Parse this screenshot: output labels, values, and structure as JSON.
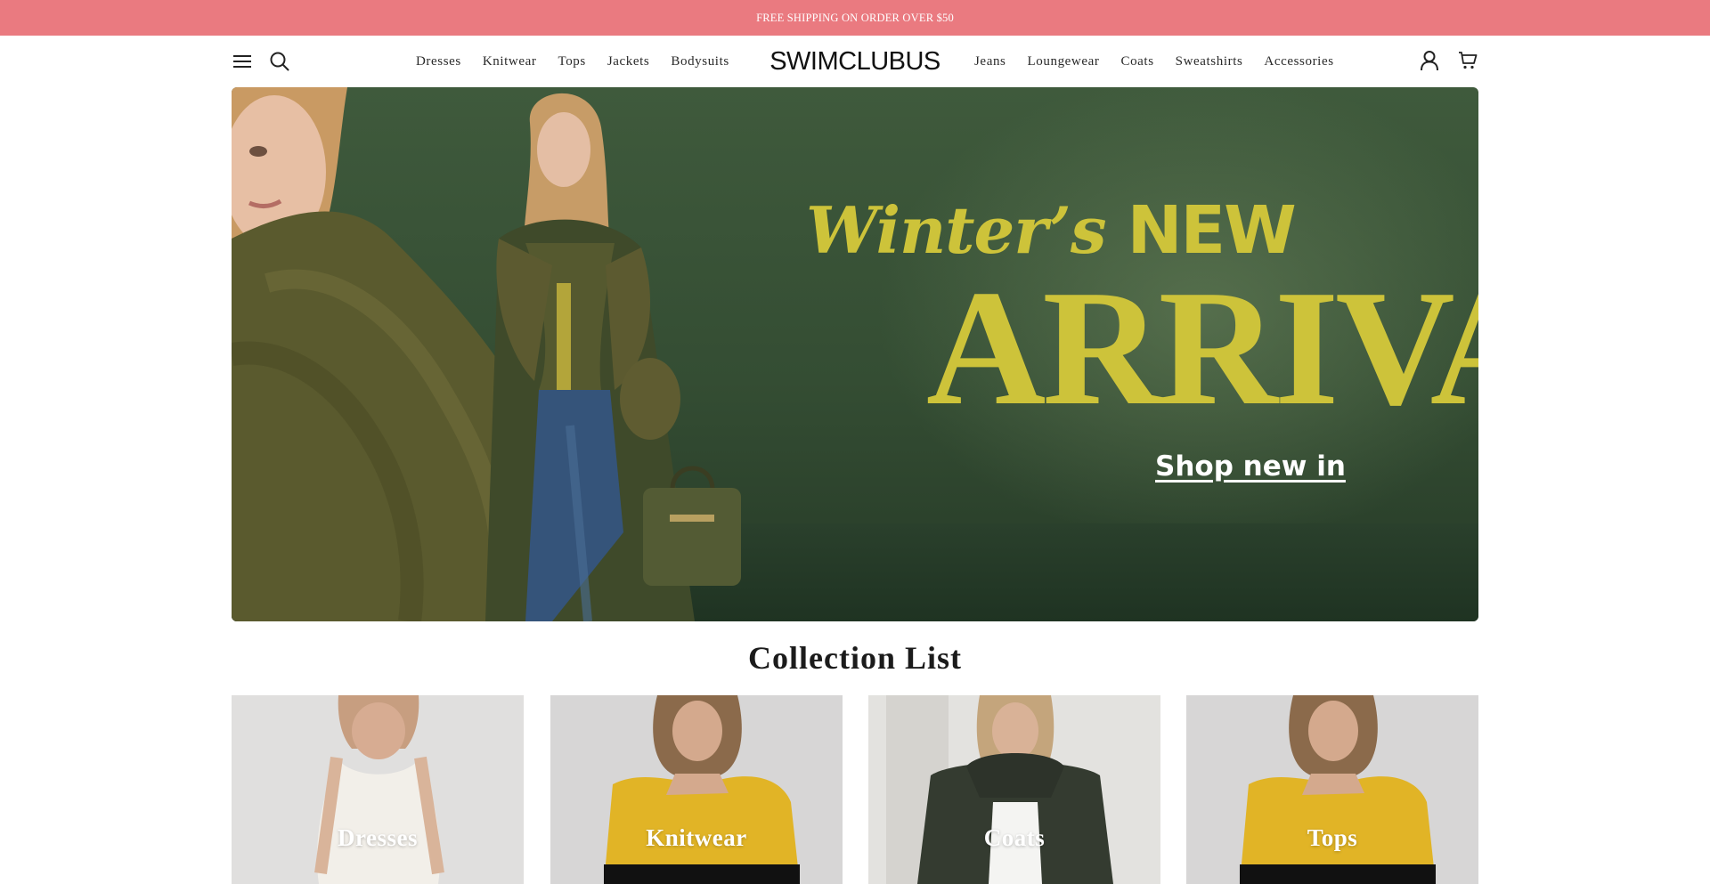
{
  "announcement": {
    "text": "FREE SHIPPING ON ORDER OVER $50"
  },
  "header": {
    "logo": "SWIMCLUBUS",
    "nav_left": [
      "Dresses",
      "Knitwear",
      "Tops",
      "Jackets",
      "Bodysuits"
    ],
    "nav_right": [
      "Jeans",
      "Loungewear",
      "Coats",
      "Sweatshirts",
      "Accessories"
    ],
    "icons": [
      "menu-icon",
      "search-icon",
      "account-icon",
      "cart-icon"
    ]
  },
  "hero": {
    "line1_prefix": "Winter’s ",
    "line1_new": "NEW",
    "line2": "ARRIVAL",
    "cta": "Shop new in",
    "accent_color": "#cdc33a",
    "background_color": "#3a5538"
  },
  "collection": {
    "title": "Collection List",
    "items": [
      {
        "label": "Dresses"
      },
      {
        "label": "Knitwear"
      },
      {
        "label": "Coats"
      },
      {
        "label": "Tops"
      }
    ]
  },
  "colors": {
    "announcement_bar": "#ea7a80",
    "text": "#1b1b1b"
  }
}
